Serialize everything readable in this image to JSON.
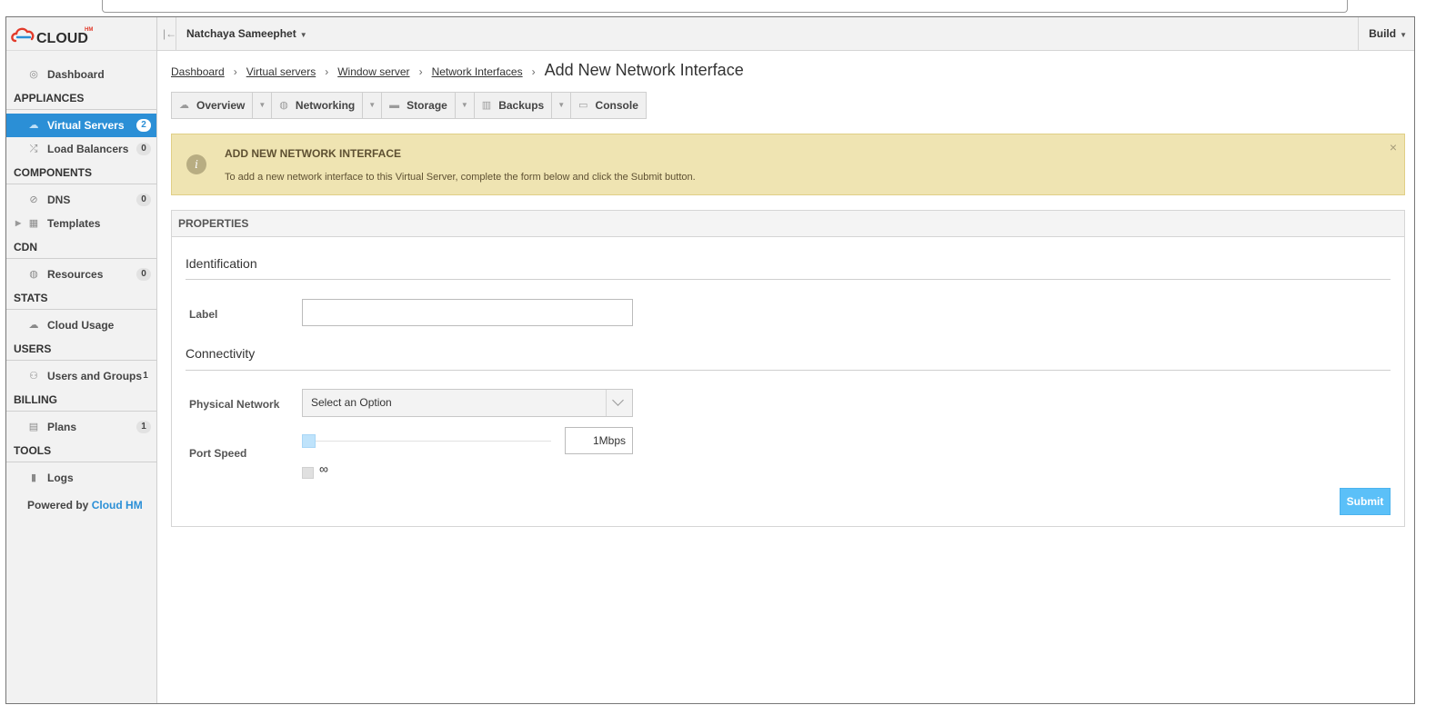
{
  "brand": {
    "logo_text": "CLOUD",
    "logo_sup": "HM"
  },
  "topbar": {
    "user": "Natchaya Sameephet",
    "build": "Build"
  },
  "sidebar": {
    "dashboard": "Dashboard",
    "sections": {
      "appliances": "APPLIANCES",
      "components": "COMPONENTS",
      "cdn": "CDN",
      "stats": "STATS",
      "users": "USERS",
      "billing": "BILLING",
      "tools": "TOOLS"
    },
    "items": {
      "virtual_servers": {
        "label": "Virtual Servers",
        "count": "2"
      },
      "load_balancers": {
        "label": "Load Balancers",
        "count": "0"
      },
      "dns": {
        "label": "DNS",
        "count": "0"
      },
      "templates": {
        "label": "Templates"
      },
      "resources": {
        "label": "Resources",
        "count": "0"
      },
      "cloud_usage": {
        "label": "Cloud Usage"
      },
      "users_groups": {
        "label": "Users and Groups",
        "count": "1"
      },
      "plans": {
        "label": "Plans",
        "count": "1"
      },
      "logs": {
        "label": "Logs"
      }
    },
    "powered_prefix": "Powered by",
    "powered_link": "Cloud HM"
  },
  "breadcrumb": {
    "items": [
      "Dashboard",
      "Virtual servers",
      "Window server",
      "Network Interfaces"
    ],
    "current": "Add New Network Interface"
  },
  "tabs": {
    "overview": "Overview",
    "networking": "Networking",
    "storage": "Storage",
    "backups": "Backups",
    "console": "Console"
  },
  "alert": {
    "title": "ADD NEW NETWORK INTERFACE",
    "text": "To add a new network interface to this Virtual Server, complete the form below and click the Submit button.",
    "close": "×",
    "icon": "i"
  },
  "form": {
    "panel_title": "PROPERTIES",
    "identification": "Identification",
    "label_field": "Label",
    "label_value": "",
    "connectivity": "Connectivity",
    "physical_network": "Physical Network",
    "physical_network_value": "Select an Option",
    "port_speed": "Port Speed",
    "port_speed_value": "1Mbps",
    "port_speed_slider_fraction": 0,
    "unlimited_symbol": "∞",
    "unlimited_checked": false,
    "submit": "Submit"
  },
  "colors": {
    "accent": "#2b8fd6",
    "alert_bg": "#efe4b2",
    "submit_bg": "#5bc0f8"
  },
  "icons": [
    "gauge-icon",
    "cloud-icon",
    "shuffle-icon",
    "compass-icon",
    "grid-icon",
    "globe-icon",
    "chart-cloud-icon",
    "users-icon",
    "document-icon",
    "clipboard-icon",
    "info-icon",
    "close-icon",
    "disk-icon",
    "archive-icon",
    "terminal-icon",
    "chevron-down-icon"
  ]
}
